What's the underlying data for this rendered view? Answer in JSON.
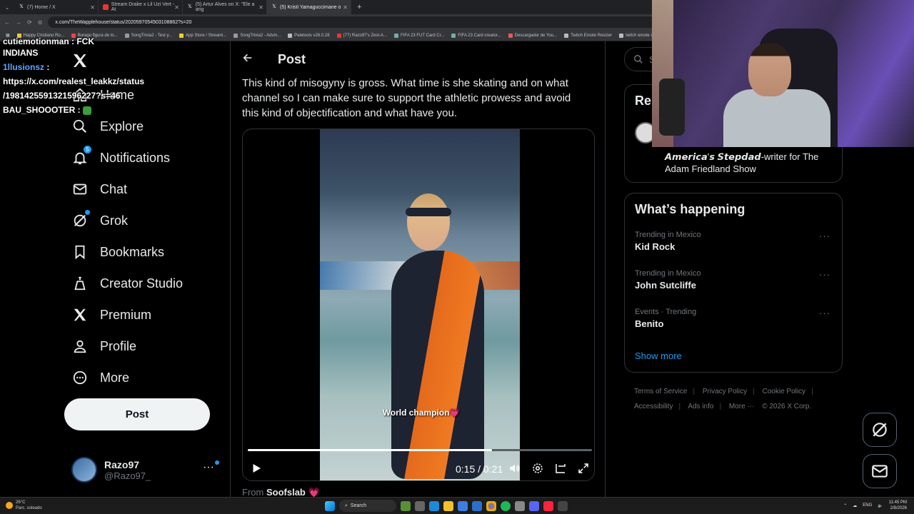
{
  "browser": {
    "tabs": [
      {
        "label": "(7) Home / X",
        "active": false
      },
      {
        "label": "Stream Drake x Lil Uzi Vert - At",
        "active": false
      },
      {
        "label": "(5) Artur Alves on X: \"Ele a ang",
        "active": false
      },
      {
        "label": "(5) Kristi Yamaguccimane o",
        "active": true
      }
    ],
    "url": "x.com/TheWapplehouse/status/2020597054503108862?s=20",
    "bookmarks": [
      "Happy Cristiano Ro...",
      "Burago figura de to...",
      "SongTrivia2 - Test y...",
      "App Store / Streami...",
      "SongTrivia2 - Advin...",
      "Paletools v26.0.28",
      "(77) Razo97's Zest-A...",
      "FIFA 23 FUT Card Cr...",
      "FIFA 23 Card creator...",
      "Descargador de You...",
      "Twitch Emote Resizer",
      "twitch emote re"
    ]
  },
  "chat": {
    "line0": "cutiemotionman : FCK",
    "line1": "INDIANS",
    "user2": "1llusionsz",
    "msg2a": "https://x.com/realest_leakkz/status",
    "msg2b": "/1981425591321596227?s=46",
    "user3": "BAU_SHOOOTER"
  },
  "nav": {
    "home": "Home",
    "explore": "Explore",
    "notifications": "Notifications",
    "notifications_badge": "5",
    "chat": "Chat",
    "grok": "Grok",
    "bookmarks": "Bookmarks",
    "creator_studio": "Creator Studio",
    "premium": "Premium",
    "profile": "Profile",
    "more": "More",
    "post_button": "Post"
  },
  "account": {
    "name": "Razo97",
    "handle": "@Razo97_"
  },
  "post": {
    "header": "Post",
    "text": "This kind of misogyny is gross. What time is she skating and on what channel so I can make sure to support the athletic prowess and avoid this kind of objectification and what have you.",
    "video_caption": "World champion💗",
    "time": "0:15 / 0:21",
    "progress": 0.71,
    "from_label": "From",
    "from_name": "Soofslab"
  },
  "right": {
    "search_placeholder": "Se",
    "relevant_title": "Rel",
    "relevant_bio": "𝘼𝙢𝙚𝙧𝙞𝙘𝙖'𝙨 𝙎𝙩𝙚𝙥𝙙𝙖𝙙-writer for The Adam Friedland Show",
    "happening_title": "What’s happening",
    "trends": [
      {
        "context": "Trending in Mexico",
        "name": "Kid Rock"
      },
      {
        "context": "Trending in Mexico",
        "name": "John Sutcliffe"
      },
      {
        "context": "Events · Trending",
        "name": "Benito"
      }
    ],
    "show_more": "Show more",
    "footer": [
      "Terms of Service",
      "Privacy Policy",
      "Cookie Policy",
      "Accessibility",
      "Ads info",
      "More ···",
      "© 2026 X Corp."
    ]
  },
  "taskbar": {
    "weather_temp": "26°C",
    "weather_desc": "Parc. soleado",
    "search": "Search",
    "lang": "ENG",
    "time": "11:45 PM",
    "date": "2/8/2026"
  }
}
